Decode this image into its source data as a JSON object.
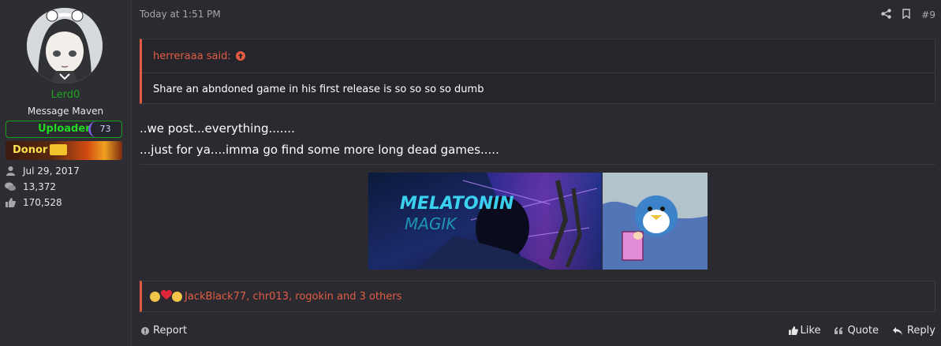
{
  "user": {
    "username": "Lerd0",
    "title": "Message Maven",
    "uploader_label": "Uploader",
    "uploader_count": "73",
    "donor_label": "Donor",
    "joined": "Jul 29, 2017",
    "messages": "13,372",
    "reactions": "170,528",
    "username_color": "#1fa51f"
  },
  "post": {
    "timestamp": "Today at 1:51 PM",
    "number": "#9",
    "quote_author": "herreraaa said:",
    "quote_text": "Share an abndoned game in his first release is so so so so dumb",
    "message_line1": "..we post...everything.......",
    "message_line2": "...just for ya....imma go find some more long dead games.....",
    "image_text": "MELATONIN MAGIK",
    "reaction_names": "JackBlack77, chr013, rogokin and 3 others"
  },
  "actions": {
    "report": "Report",
    "like": "Like",
    "quote": "Quote",
    "reply": "Reply"
  },
  "colors": {
    "accent": "#e25c43",
    "background": "#2b2a30",
    "uploader_green": "#22d822",
    "donor_yellow": "#ffe14d"
  }
}
